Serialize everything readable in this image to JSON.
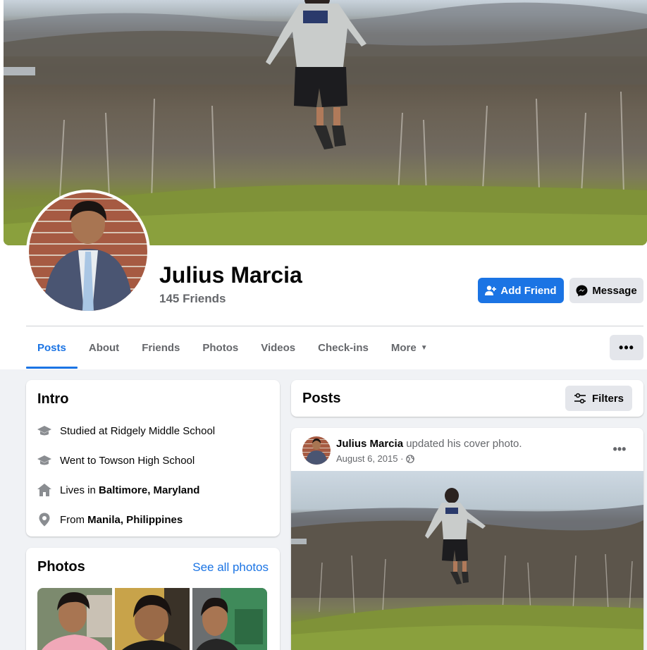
{
  "profile": {
    "name": "Julius Marcia",
    "friends": "145 Friends"
  },
  "actions": {
    "add_friend": "Add Friend",
    "message": "Message",
    "more": "•••"
  },
  "tabs": [
    {
      "label": "Posts",
      "active": true
    },
    {
      "label": "About"
    },
    {
      "label": "Friends"
    },
    {
      "label": "Photos"
    },
    {
      "label": "Videos"
    },
    {
      "label": "Check-ins"
    },
    {
      "label": "More"
    }
  ],
  "intro": {
    "title": "Intro",
    "items": [
      {
        "icon": "graduation-cap-icon",
        "prefix": "Studied at Ridgely Middle School",
        "bold": ""
      },
      {
        "icon": "graduation-cap-icon",
        "prefix": "Went to Towson High School",
        "bold": ""
      },
      {
        "icon": "home-icon",
        "prefix": "Lives in ",
        "bold": "Baltimore, Maryland"
      },
      {
        "icon": "location-pin-icon",
        "prefix": "From ",
        "bold": "Manila, Philippines"
      }
    ]
  },
  "photos": {
    "title": "Photos",
    "see_all": "See all photos"
  },
  "posts_header": {
    "title": "Posts",
    "filters": "Filters"
  },
  "post": {
    "author": "Julius Marcia",
    "action": " updated his cover photo.",
    "date": "August 6, 2015 ·",
    "privacy_icon": "globe-icon",
    "more": "•••"
  },
  "colors": {
    "accent": "#1b74e4",
    "secondary_text": "#65676b",
    "background": "#f0f2f5"
  }
}
